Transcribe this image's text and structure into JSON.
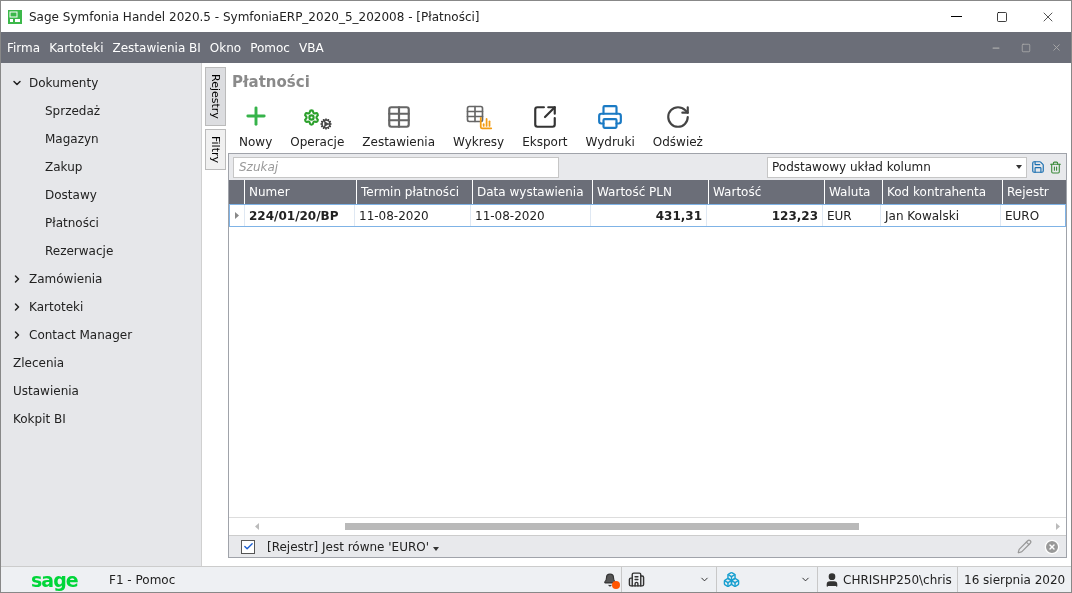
{
  "window": {
    "title": "Sage Symfonia Handel 2020.5 - SymfoniaERP_2020_5_202008 - [Płatności]"
  },
  "menu": [
    "Firma",
    "Kartoteki",
    "Zestawienia BI",
    "Okno",
    "Pomoc",
    "VBA"
  ],
  "sidebar": {
    "items": [
      {
        "label": "Dokumenty",
        "kind": "group",
        "expanded": true,
        "children": [
          {
            "label": "Sprzedaż"
          },
          {
            "label": "Magazyn"
          },
          {
            "label": "Zakup"
          },
          {
            "label": "Dostawy"
          },
          {
            "label": "Płatności"
          },
          {
            "label": "Rezerwacje"
          }
        ]
      },
      {
        "label": "Zamówienia",
        "kind": "group",
        "expanded": false
      },
      {
        "label": "Kartoteki",
        "kind": "group",
        "expanded": false
      },
      {
        "label": "Contact Manager",
        "kind": "group",
        "expanded": false
      },
      {
        "label": "Zlecenia",
        "kind": "link"
      },
      {
        "label": "Ustawienia",
        "kind": "link"
      },
      {
        "label": "Kokpit BI",
        "kind": "link"
      }
    ]
  },
  "side_tabs": [
    {
      "label": "Rejestry",
      "selected": true
    },
    {
      "label": "Filtry",
      "selected": false
    }
  ],
  "page_title": "Płatności",
  "toolbar": [
    {
      "label": "Nowy",
      "kind": "new"
    },
    {
      "label": "Operacje",
      "kind": "operations"
    },
    {
      "label": "Zestawienia",
      "kind": "table"
    },
    {
      "label": "Wykresy",
      "kind": "charts"
    },
    {
      "label": "Eksport",
      "kind": "export"
    },
    {
      "label": "Wydruki",
      "kind": "print"
    },
    {
      "label": "Odśwież",
      "kind": "refresh"
    }
  ],
  "search": {
    "placeholder": "Szukaj"
  },
  "layout_select": {
    "value": "Podstawowy układ kolumn"
  },
  "table": {
    "columns": [
      {
        "label": "Numer",
        "kind": "key"
      },
      {
        "label": "Termin płatności",
        "kind": "text"
      },
      {
        "label": "Data wystawienia",
        "kind": "text"
      },
      {
        "label": "Wartość PLN",
        "kind": "amount"
      },
      {
        "label": "Wartość",
        "kind": "amount"
      },
      {
        "label": "Waluta",
        "kind": "text"
      },
      {
        "label": "Kod kontrahenta",
        "kind": "text"
      },
      {
        "label": "Rejestr",
        "kind": "text"
      }
    ],
    "rows": [
      {
        "selected": true,
        "cells": [
          "224/01/20/BP",
          "11-08-2020",
          "11-08-2020",
          "431,31",
          "123,23",
          "EUR",
          "Jan Kowalski",
          "EURO"
        ]
      }
    ]
  },
  "filter": {
    "checked": true,
    "text": "[Rejestr] Jest równe 'EURO'"
  },
  "status_bar": {
    "logo": "sage",
    "help": "F1 - Pomoc",
    "user": "CHRISHP250\\chris",
    "date": "16 sierpnia 2020"
  }
}
